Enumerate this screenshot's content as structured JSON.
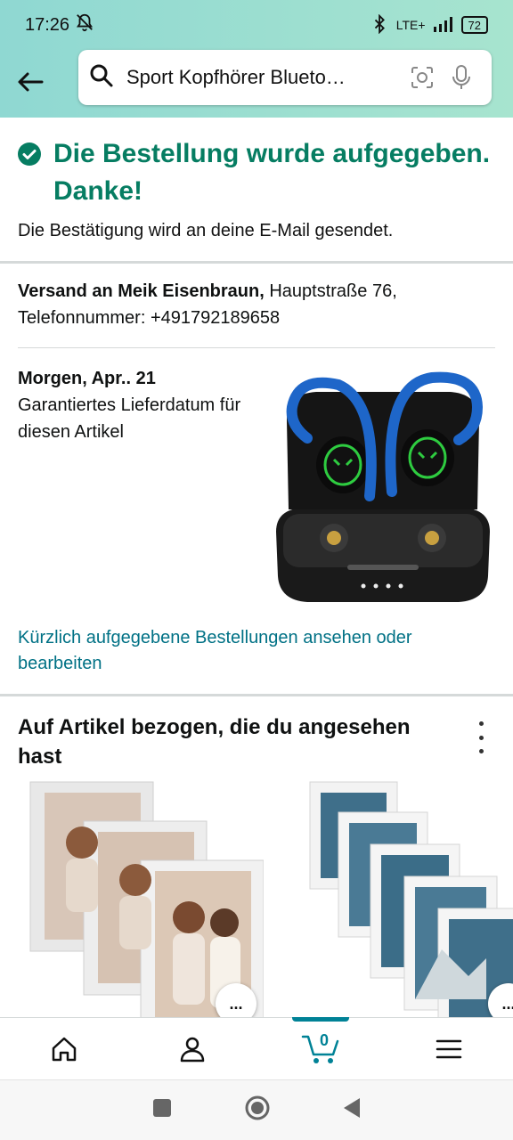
{
  "status": {
    "time": "17:26",
    "network": "LTE+",
    "battery": "72"
  },
  "search": {
    "query": "Sport Kopfhörer Blueto…"
  },
  "confirmation": {
    "title": "Die Bestellung wurde aufgegeben. Danke!",
    "subtitle": "Die Bestätigung wird an deine E-Mail gesendet."
  },
  "shipping": {
    "label": "Versand an Meik Eisenbraun,",
    "address": " Hauptstraße 76,",
    "phone": "Telefonnummer: +491792189658"
  },
  "delivery": {
    "date": "Morgen, Apr.. 21",
    "note": "Garantiertes Lieferdatum für diesen Artikel",
    "orders_link": "Kürzlich aufgegebene Bestellungen ansehen oder bearbeiten"
  },
  "related": {
    "title": "Auf Artikel bezogen, die du angesehen hast",
    "more_label": "..."
  },
  "bottom_nav": {
    "cart_count": "0"
  },
  "colors": {
    "success": "#067d62",
    "link": "#007185",
    "accent": "#008296",
    "header": "#a7e4cf"
  }
}
